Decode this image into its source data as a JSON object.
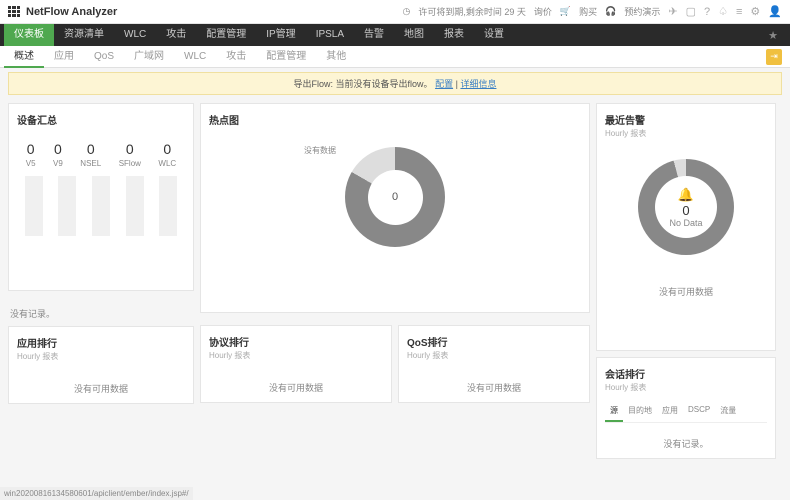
{
  "header": {
    "title": "NetFlow Analyzer",
    "trial_text": "许可将到期,剩余时间 29 天",
    "links": [
      "询价",
      "购买",
      "预约演示"
    ]
  },
  "nav_main": [
    "仪表板",
    "资源清单",
    "WLC",
    "攻击",
    "配置管理",
    "IP管理",
    "IPSLA",
    "告警",
    "地图",
    "报表",
    "设置"
  ],
  "nav_sub": [
    "概述",
    "应用",
    "QoS",
    "广域网",
    "WLC",
    "攻击",
    "配置管理",
    "其他"
  ],
  "banner": {
    "prefix": "导出Flow: 当前没有设备导出flow。",
    "link1": "配置",
    "sep": " | ",
    "link2": "详细信息"
  },
  "cards": {
    "device": {
      "title": "设备汇总",
      "stats": [
        {
          "num": "0",
          "lbl": "V5"
        },
        {
          "num": "0",
          "lbl": "V9"
        },
        {
          "num": "0",
          "lbl": "NSEL"
        },
        {
          "num": "0",
          "lbl": "SFlow"
        },
        {
          "num": "0",
          "lbl": "WLC"
        }
      ],
      "norec": "没有记录。"
    },
    "hot": {
      "title": "热点图",
      "label": "没有数据",
      "center": "0"
    },
    "alert": {
      "title": "最近告警",
      "sub": "Hourly 报表",
      "num": "0",
      "txt": "No Data",
      "nodata": "没有可用数据"
    },
    "app_rank": {
      "title": "应用排行",
      "sub": "Hourly 报表",
      "nodata": "没有可用数据"
    },
    "proto_rank": {
      "title": "协议排行",
      "sub": "Hourly 报表",
      "nodata": "没有可用数据"
    },
    "qos_rank": {
      "title": "QoS排行",
      "sub": "Hourly 报表",
      "nodata": "没有可用数据"
    },
    "session": {
      "title": "会话排行",
      "sub": "Hourly 报表",
      "tabs": [
        "源",
        "目的地",
        "应用",
        "DSCP",
        "流量"
      ],
      "norec": "没有记录。"
    }
  },
  "status": "win20200816134580601/apiclient/ember/index.jsp#/",
  "chart_data": [
    {
      "type": "pie",
      "title": "热点图",
      "series": [
        {
          "name": "没有数据",
          "value": 0
        }
      ],
      "center_value": 0
    },
    {
      "type": "pie",
      "title": "最近告警",
      "series": [
        {
          "name": "No Data",
          "value": 0
        }
      ],
      "center_value": 0
    }
  ]
}
